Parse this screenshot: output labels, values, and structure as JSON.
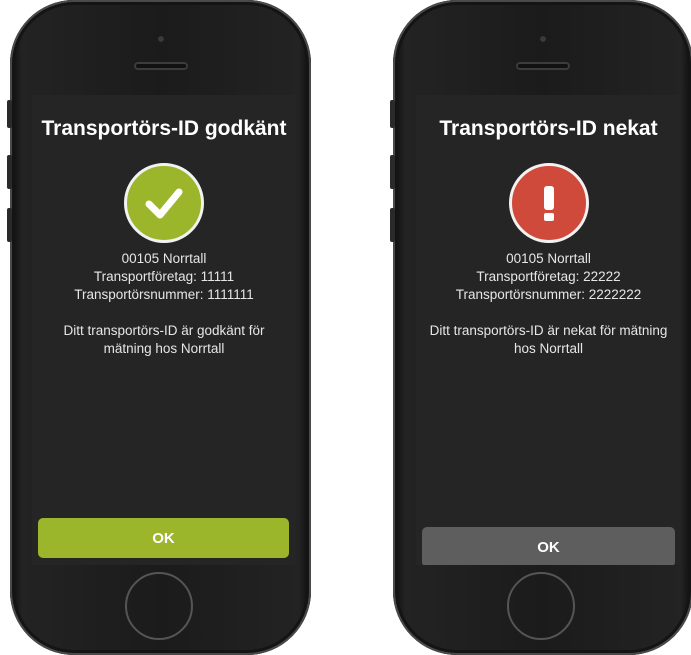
{
  "screens": [
    {
      "title": "Transportörs-ID godkänt",
      "status": "approved",
      "status_icon": "checkmark-icon",
      "status_color": "#9bb62b",
      "line1": "00105 Norrtall",
      "line2": "Transportföretag: 11111",
      "line3": "Transportörsnummer: 1111111",
      "message": "Ditt transportörs-ID är godkänt för mätning hos Norrtall",
      "ok_label": "OK",
      "button_color": "#9bb62b"
    },
    {
      "title": "Transportörs-ID nekat",
      "status": "denied",
      "status_icon": "exclamation-icon",
      "status_color": "#d04a3c",
      "line1": "00105 Norrtall",
      "line2": "Transportföretag: 22222",
      "line3": "Transportörsnummer: 2222222",
      "message": "Ditt transportörs-ID är nekat för mätning hos Norrtall",
      "ok_label": "OK",
      "button_color": "#5e5e5e"
    }
  ]
}
